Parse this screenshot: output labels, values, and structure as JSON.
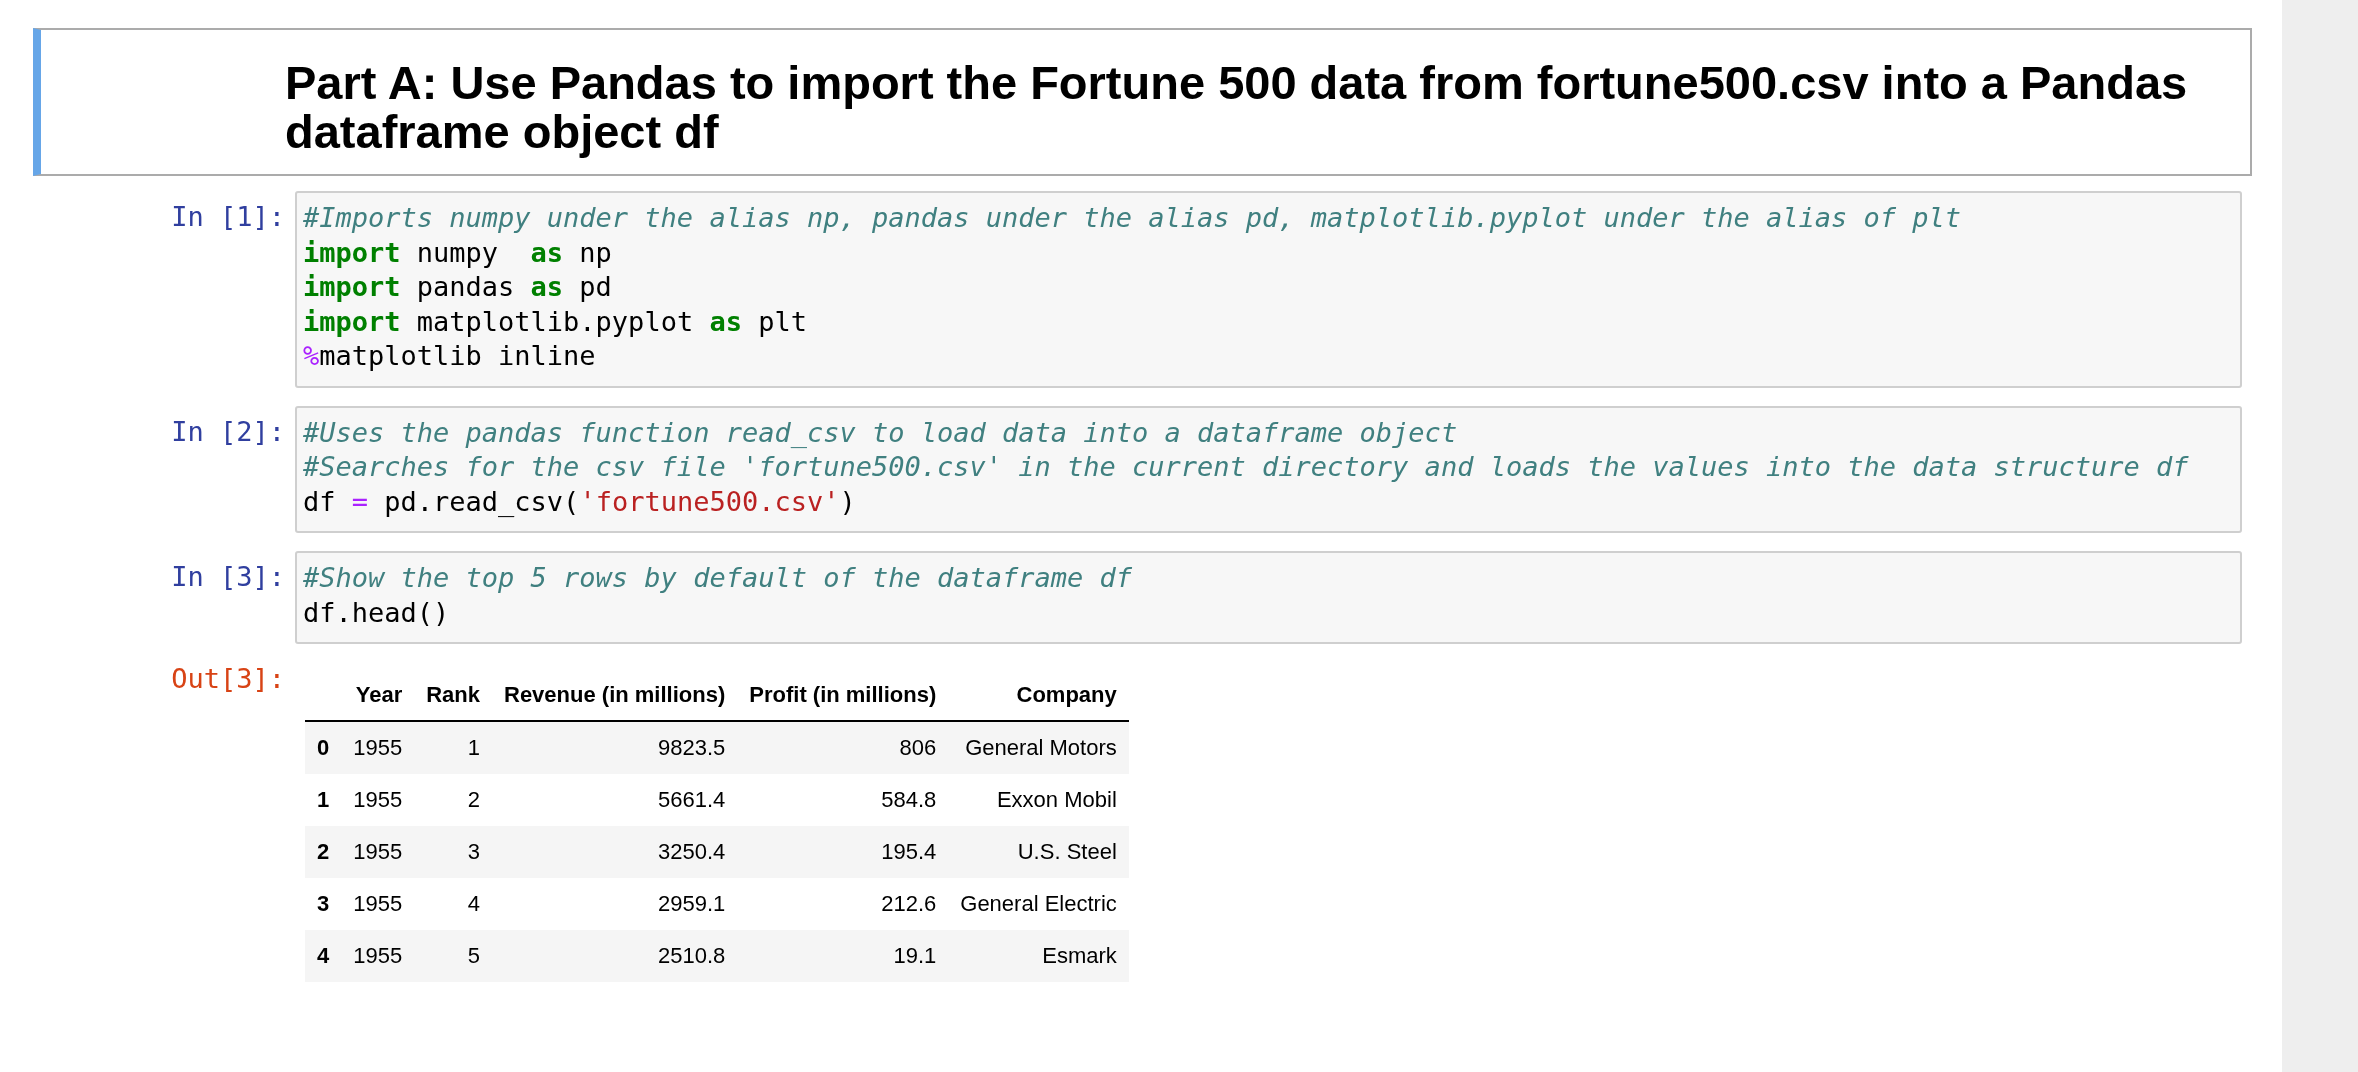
{
  "markdown_cell": {
    "heading": "Part A: Use Pandas to import the Fortune 500 data from fortune500.csv into a Pandas dataframe object df"
  },
  "code_cells": [
    {
      "prompt": "In [1]:",
      "lines": [
        [
          {
            "kind": "comment",
            "text": "#Imports numpy under the alias np, pandas under the alias pd, matplotlib.pyplot under the alias of plt"
          }
        ],
        [
          {
            "kind": "keyword",
            "text": "import"
          },
          {
            "kind": "plain",
            "text": " numpy  "
          },
          {
            "kind": "keyword",
            "text": "as"
          },
          {
            "kind": "plain",
            "text": " np"
          }
        ],
        [
          {
            "kind": "keyword",
            "text": "import"
          },
          {
            "kind": "plain",
            "text": " pandas "
          },
          {
            "kind": "keyword",
            "text": "as"
          },
          {
            "kind": "plain",
            "text": " pd"
          }
        ],
        [
          {
            "kind": "keyword",
            "text": "import"
          },
          {
            "kind": "plain",
            "text": " matplotlib.pyplot "
          },
          {
            "kind": "keyword",
            "text": "as"
          },
          {
            "kind": "plain",
            "text": " plt"
          }
        ],
        [
          {
            "kind": "magic",
            "text": "%"
          },
          {
            "kind": "plain",
            "text": "matplotlib inline"
          }
        ]
      ]
    },
    {
      "prompt": "In [2]:",
      "lines": [
        [
          {
            "kind": "comment",
            "text": "#Uses the pandas function read_csv to load data into a dataframe object"
          }
        ],
        [
          {
            "kind": "comment",
            "text": "#Searches for the csv file 'fortune500.csv' in the current directory and loads the values into the data structure df"
          }
        ],
        [
          {
            "kind": "plain",
            "text": "df "
          },
          {
            "kind": "operator",
            "text": "="
          },
          {
            "kind": "plain",
            "text": " pd.read_csv("
          },
          {
            "kind": "string",
            "text": "'fortune500.csv'"
          },
          {
            "kind": "plain",
            "text": ")"
          }
        ]
      ]
    },
    {
      "prompt": "In [3]:",
      "lines": [
        [
          {
            "kind": "comment",
            "text": "#Show the top 5 rows by default of the dataframe df"
          }
        ],
        [
          {
            "kind": "plain",
            "text": "df.head()"
          }
        ]
      ]
    }
  ],
  "output": {
    "prompt": "Out[3]:",
    "table": {
      "columns": [
        "Year",
        "Rank",
        "Revenue (in millions)",
        "Profit (in millions)",
        "Company"
      ],
      "rows": [
        {
          "index": "0",
          "cells": [
            "1955",
            "1",
            "9823.5",
            "806",
            "General Motors"
          ]
        },
        {
          "index": "1",
          "cells": [
            "1955",
            "2",
            "5661.4",
            "584.8",
            "Exxon Mobil"
          ]
        },
        {
          "index": "2",
          "cells": [
            "1955",
            "3",
            "3250.4",
            "195.4",
            "U.S. Steel"
          ]
        },
        {
          "index": "3",
          "cells": [
            "1955",
            "4",
            "2959.1",
            "212.6",
            "General Electric"
          ]
        },
        {
          "index": "4",
          "cells": [
            "1955",
            "5",
            "2510.8",
            "19.1",
            "Esmark"
          ]
        }
      ]
    }
  }
}
